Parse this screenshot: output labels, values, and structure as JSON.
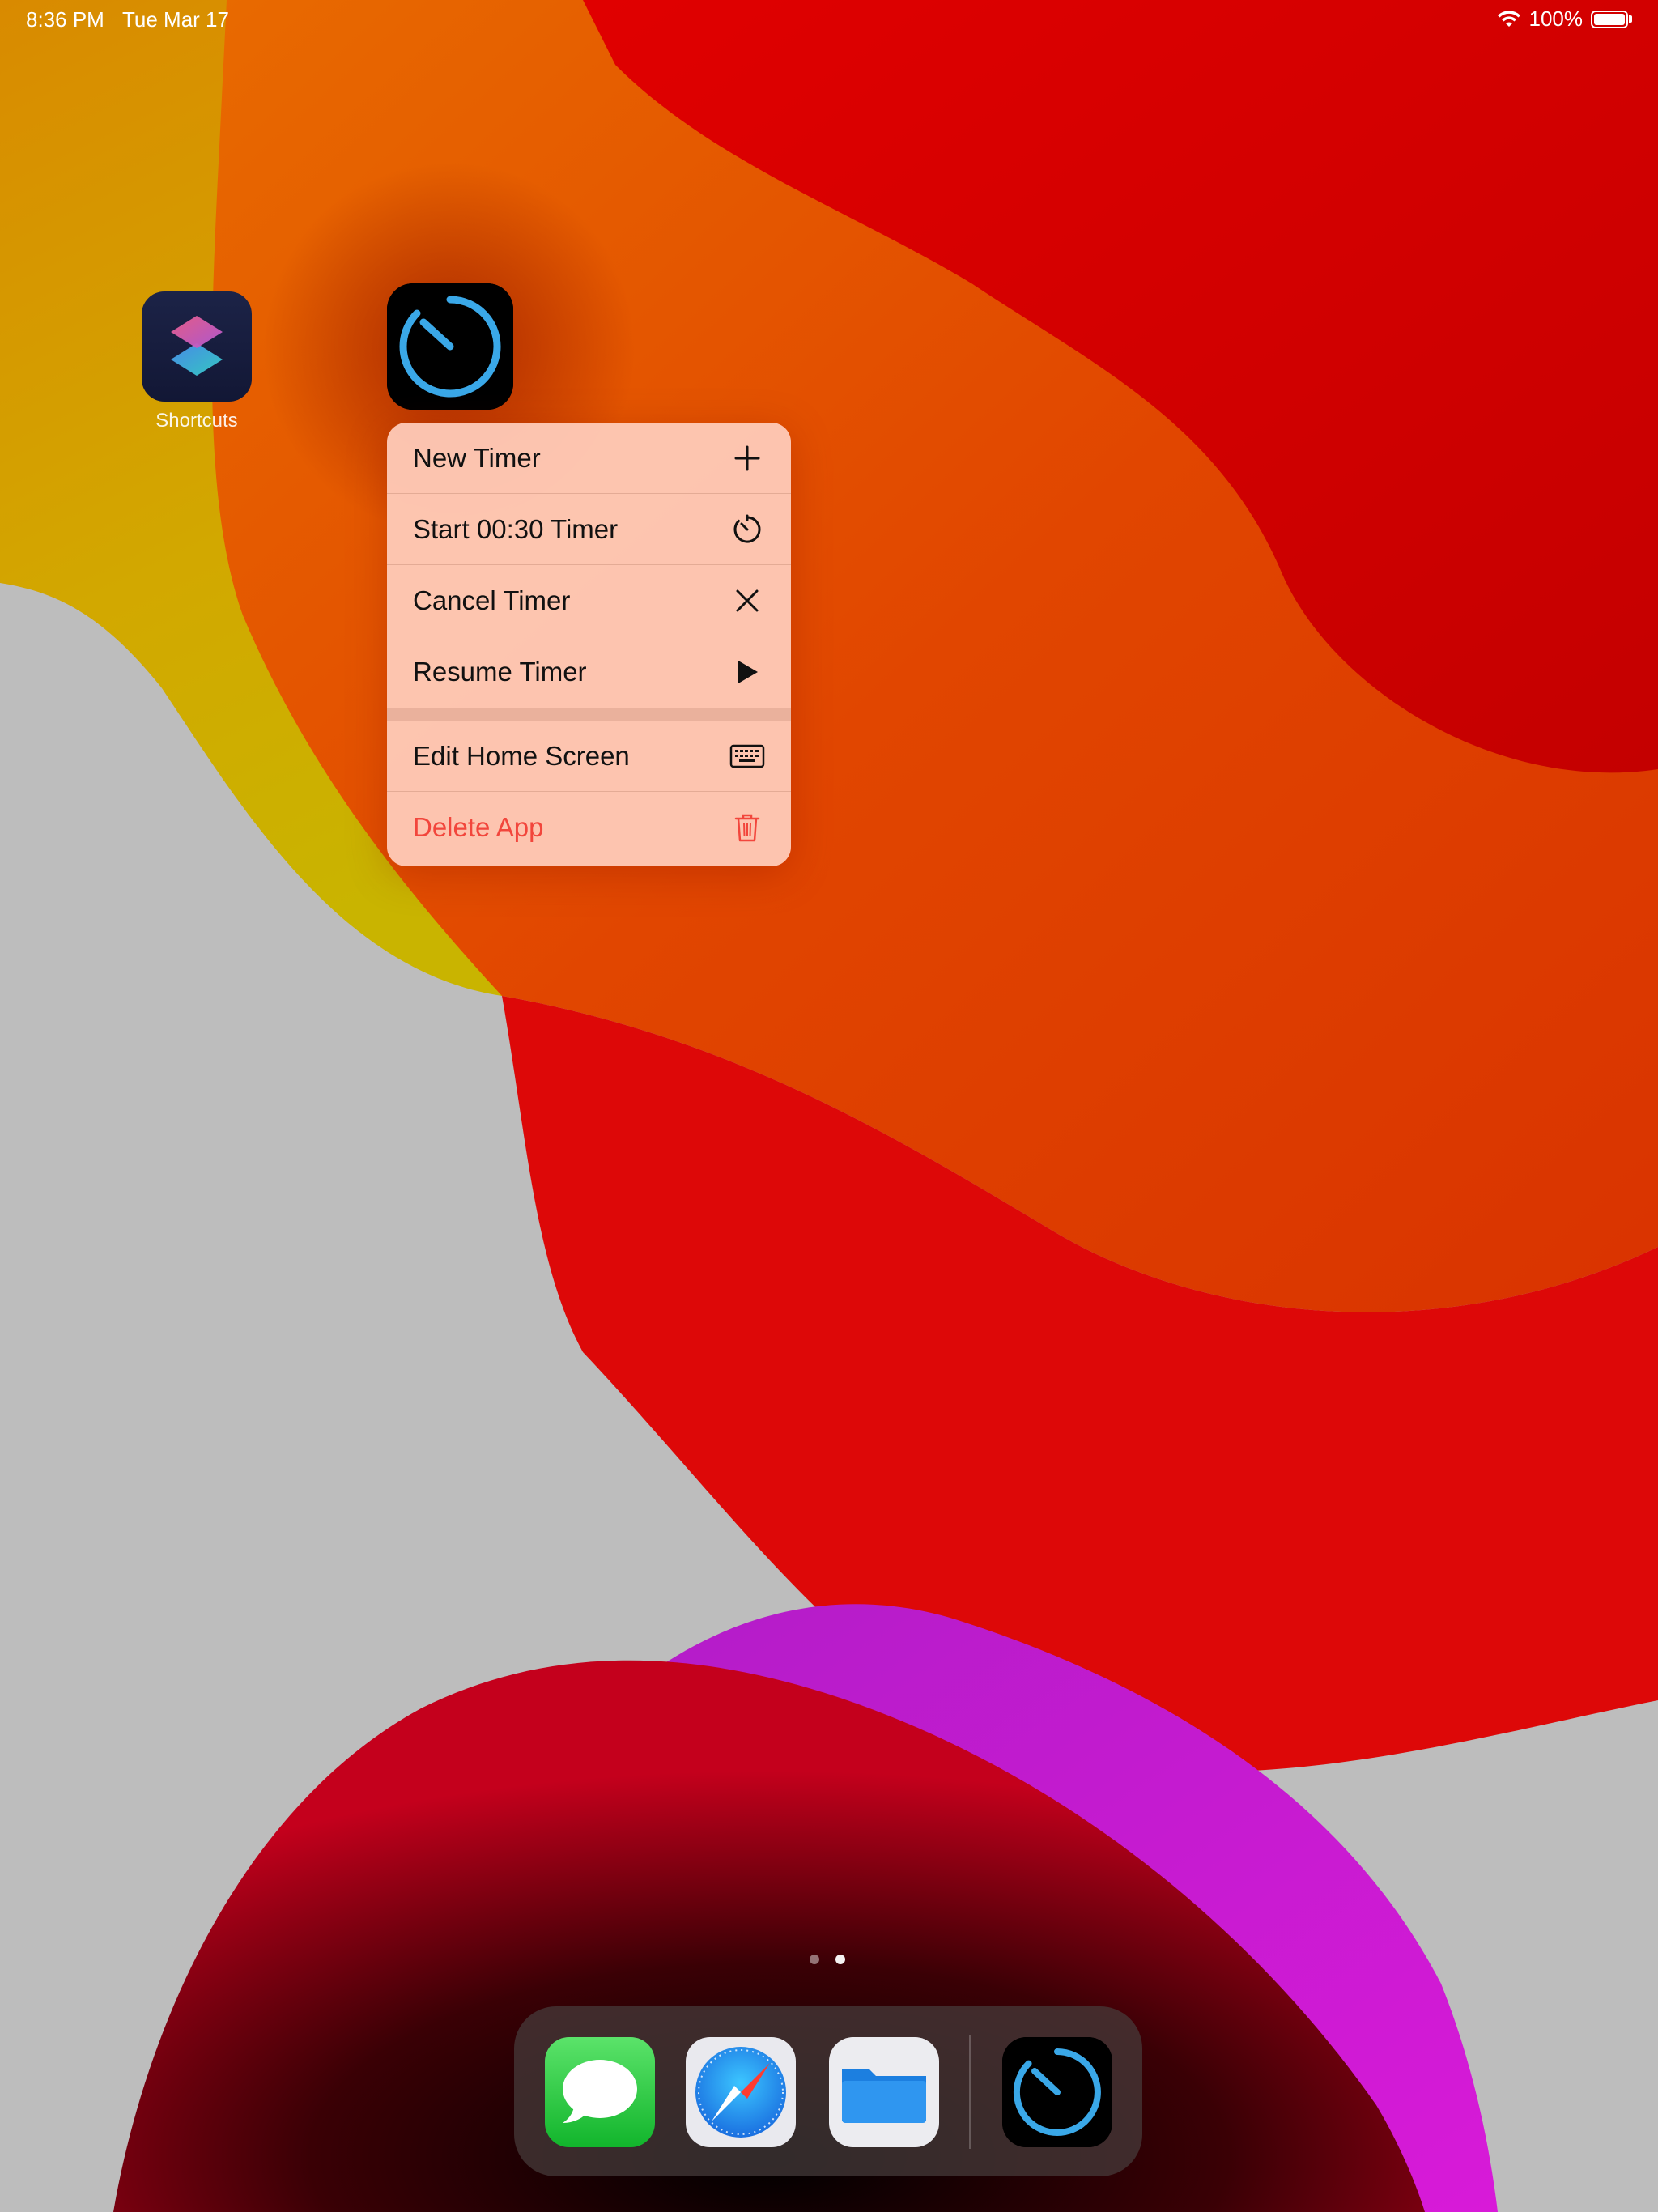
{
  "status_bar": {
    "time": "8:36 PM",
    "date": "Tue Mar 17",
    "battery": "100%",
    "wifi_icon": "wifi-icon",
    "battery_icon": "battery-icon"
  },
  "home_apps": [
    {
      "label": "Shortcuts",
      "icon": "shortcuts-icon"
    },
    {
      "label": "",
      "icon": "timer-icon"
    }
  ],
  "context_menu": {
    "items": [
      {
        "label": "New Timer",
        "icon": "plus-icon"
      },
      {
        "label": "Start 00:30 Timer",
        "icon": "timer-icon"
      },
      {
        "label": "Cancel Timer",
        "icon": "close-icon"
      },
      {
        "label": "Resume Timer",
        "icon": "play-icon"
      },
      {
        "label": "Edit Home Screen",
        "icon": "keyboard-icon"
      },
      {
        "label": "Delete App",
        "icon": "trash-icon",
        "destructive": true
      }
    ]
  },
  "page_indicator": {
    "pages": 2,
    "current": 2
  },
  "dock": {
    "apps": [
      {
        "icon": "messages-icon"
      },
      {
        "icon": "safari-icon"
      },
      {
        "icon": "files-icon"
      },
      {
        "icon": "timer-icon"
      }
    ]
  },
  "colors": {
    "timer_accent": "#3aa8e8",
    "destructive": "#f2463c",
    "menu_background": "#ffcdbc"
  }
}
